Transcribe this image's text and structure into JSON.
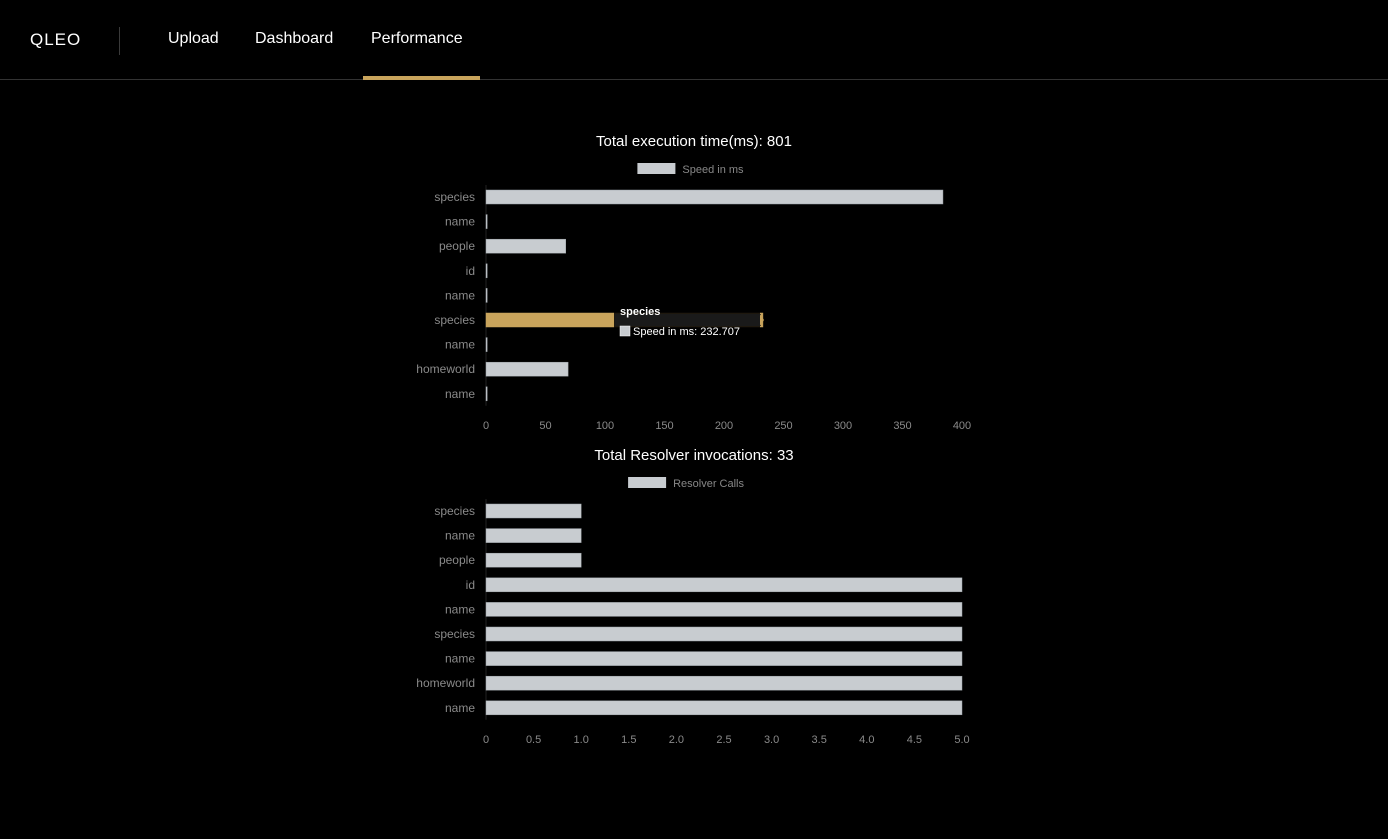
{
  "app": {
    "brand": "QLEO",
    "nav": [
      {
        "label": "Upload"
      },
      {
        "label": "Dashboard"
      },
      {
        "label": "Performance",
        "active": true
      }
    ],
    "accent_color": "#c9a45c"
  },
  "chart_data": [
    {
      "type": "bar",
      "orientation": "horizontal",
      "title": "Total execution time(ms): 801",
      "categories": [
        "species",
        "name",
        "people",
        "id",
        "name",
        "species",
        "name",
        "homeworld",
        "name"
      ],
      "series": [
        {
          "name": "Speed in ms",
          "values": [
            384,
            1,
            67,
            1,
            1,
            232.707,
            1,
            69,
            1
          ]
        }
      ],
      "xlim": [
        0,
        400
      ],
      "xticks": [
        "0",
        "50",
        "100",
        "150",
        "200",
        "250",
        "300",
        "350",
        "400"
      ],
      "highlighted_index": 5,
      "tooltip": {
        "title": "species",
        "label": "Speed in ms: 232.707"
      },
      "bar_color": "#c8ccd0",
      "highlight_color": "#c9a45c",
      "legend_position": "top"
    },
    {
      "type": "bar",
      "orientation": "horizontal",
      "title": "Total Resolver invocations: 33",
      "categories": [
        "species",
        "name",
        "people",
        "id",
        "name",
        "species",
        "name",
        "homeworld",
        "name"
      ],
      "series": [
        {
          "name": "Resolver Calls",
          "values": [
            1,
            1,
            1,
            5,
            5,
            5,
            5,
            5,
            5
          ]
        }
      ],
      "xlim": [
        0,
        5
      ],
      "xticks": [
        "0",
        "0.5",
        "1.0",
        "1.5",
        "2.0",
        "2.5",
        "3.0",
        "3.5",
        "4.0",
        "4.5",
        "5.0"
      ],
      "bar_color": "#c8ccd0",
      "legend_position": "top"
    }
  ]
}
